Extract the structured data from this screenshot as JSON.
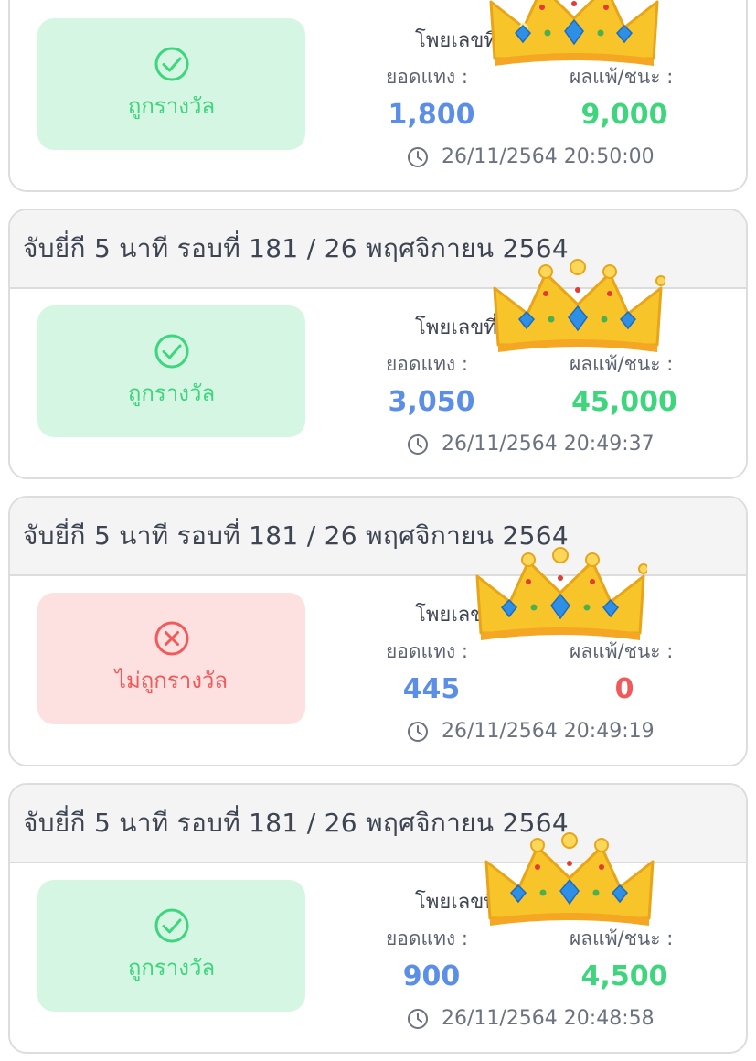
{
  "cards": [
    {
      "has_header": false,
      "header": "",
      "status": "win",
      "status_label": "ถูกรางวัล",
      "bet_number_label": "โพยเลขที่",
      "bet_amount_label": "ยอดแทง :",
      "result_label": "ผลแพ้/ชนะ :",
      "bet_amount": "1,800",
      "result_amount": "9,000",
      "timestamp": "26/11/2564 20:50:00"
    },
    {
      "has_header": true,
      "header": "จับยี่กี 5 นาที รอบที่ 181 / 26 พฤศจิกายน 2564",
      "status": "win",
      "status_label": "ถูกรางวัล",
      "bet_number_label": "โพยเลขที่",
      "bet_amount_label": "ยอดแทง :",
      "result_label": "ผลแพ้/ชนะ :",
      "bet_amount": "3,050",
      "result_amount": "45,000",
      "timestamp": "26/11/2564 20:49:37"
    },
    {
      "has_header": true,
      "header": "จับยี่กี 5 นาที รอบที่ 181 / 26 พฤศจิกายน 2564",
      "status": "lose",
      "status_label": "ไม่ถูกรางวัล",
      "bet_number_label": "โพยเลขที่",
      "bet_amount_label": "ยอดแทง :",
      "result_label": "ผลแพ้/ชนะ :",
      "bet_amount": "445",
      "result_amount": "0",
      "timestamp": "26/11/2564 20:49:19"
    },
    {
      "has_header": true,
      "header": "จับยี่กี 5 นาที รอบที่ 181 / 26 พฤศจิกายน 2564",
      "status": "win",
      "status_label": "ถูกรางวัล",
      "bet_number_label": "โพยเลขที่",
      "bet_amount_label": "ยอดแทง :",
      "result_label": "ผลแพ้/ชนะ :",
      "bet_amount": "900",
      "result_amount": "4,500",
      "timestamp": "26/11/2564 20:48:58"
    }
  ],
  "icons": {
    "win": "check-circle-icon",
    "lose": "x-circle-icon",
    "time": "clock-icon",
    "overlay": "crown-sticker"
  },
  "colors": {
    "win": "#3dd67d",
    "win_bg": "#d6f6e4",
    "lose": "#f05a5a",
    "lose_bg": "#fde0e0",
    "bet_amount": "#5b8ee6",
    "header_bg": "#f4f4f4"
  }
}
